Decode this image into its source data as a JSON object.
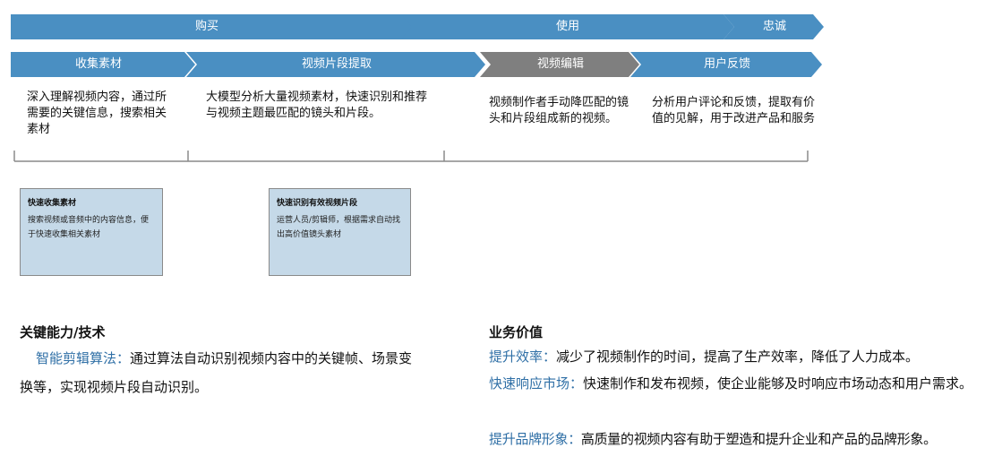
{
  "phases": [
    {
      "label": "购买"
    },
    {
      "label": "使用"
    },
    {
      "label": "忠诚"
    }
  ],
  "steps": [
    {
      "label": "收集素材",
      "desc": "深入理解视频内容，通过所需要的关键信息，搜索相关素材"
    },
    {
      "label": "视频片段提取",
      "desc": "大模型分析大量视频素材，快速识别和推荐与视频主题最匹配的镜头和片段。"
    },
    {
      "label": "视频编辑",
      "desc": "视频制作者手动降匹配的镜头和片段组成新的视频。"
    },
    {
      "label": "用户反馈",
      "desc": "分析用户评论和反馈，提取有价值的见解，用于改进产品和服务"
    }
  ],
  "cards": [
    {
      "title": "快速收集素材",
      "body": "搜索视频或音频中的内容信息，便于快速收集相关素材"
    },
    {
      "title": "快速识别有效视频片段",
      "body": "运营人员/剪辑师，根据需求自动找出高价值镜头素材"
    }
  ],
  "key_capability": {
    "title": "关键能力/技术",
    "items": [
      {
        "term": "智能剪辑算法：",
        "text": "通过算法自动识别视频内容中的关键帧、场景变换等，实现视频片段自动识别。"
      }
    ]
  },
  "business_value": {
    "title": "业务价值",
    "items": [
      {
        "term": "提升效率：",
        "text": "减少了视频制作的时间，提高了生产效率，降低了人力成本。"
      },
      {
        "term": "快速响应市场：",
        "text": "快速制作和发布视频，使企业能够及时响应市场动态和用户需求。"
      },
      {
        "term": "提升品牌形象：",
        "text": "高质量的视频内容有助于塑造和提升企业和产品的品牌形象。"
      }
    ]
  },
  "colors": {
    "blue": "#4a8fc2",
    "gray": "#7f7f7f",
    "card_bg": "#c5d9e8",
    "highlight": "#2f6fa6"
  }
}
